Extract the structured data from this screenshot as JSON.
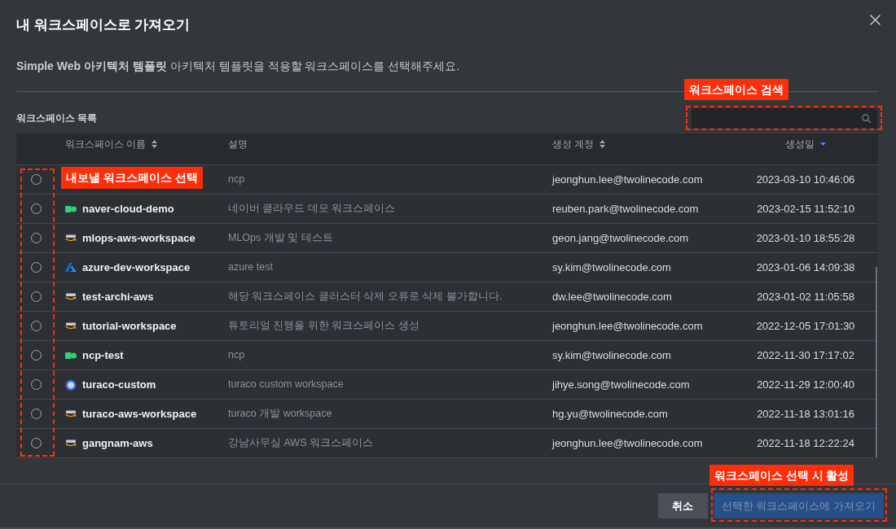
{
  "dialog": {
    "title": "내 워크스페이스로 가져오기"
  },
  "description": "**Simple Web 아키텍처 템플릿** 아키텍처 템플릿을 적용할 워크스페이스를 선택해주세요.",
  "list_title": "워크스페이스 목록",
  "search": {
    "annotation": "워크스페이스 검색"
  },
  "table": {
    "annotation": "내보낼 워크스페이스 선택",
    "columns": [
      {
        "label": "워크스페이스 이름",
        "sortable": true,
        "sorted": false
      },
      {
        "label": "설명",
        "sortable": false,
        "sorted": false
      },
      {
        "label": "생성 계정",
        "sortable": true,
        "sorted": false
      },
      {
        "label": "생성일",
        "sortable": true,
        "sorted": true
      }
    ],
    "rows": [
      {
        "selected": false,
        "description": "ncp",
        "account": "jeonghun.lee@twolinecode.com",
        "created": "2023-03-10 10:46:06"
      },
      {
        "selected": false,
        "kind": "ncp",
        "name": "naver-cloud-demo",
        "description": "네이버 클라우드 데모 워크스페이스",
        "account": "reuben.park@twolinecode.com",
        "created": "2023-02-15 11:52:10"
      },
      {
        "selected": false,
        "kind": "aws",
        "name": "mlops-aws-workspace",
        "description": "MLOps 개발 및 테스트",
        "account": "geon.jang@twolinecode.com",
        "created": "2023-01-10 18:55:28"
      },
      {
        "selected": false,
        "kind": "azure",
        "name": "azure-dev-workspace",
        "description": "azure test",
        "account": "sy.kim@twolinecode.com",
        "created": "2023-01-06 14:09:38"
      },
      {
        "selected": false,
        "kind": "aws",
        "name": "test-archi-aws",
        "description": "해당 워크스페이스 클러스터 삭제 오류로 삭제 불가합니다.",
        "account": "dw.lee@twolinecode.com",
        "created": "2023-01-02 11:05:58"
      },
      {
        "selected": false,
        "kind": "aws",
        "name": "tutorial-workspace",
        "description": "튜토리얼 진행을 위한 워크스페이스 생성",
        "account": "jeonghun.lee@twolinecode.com",
        "created": "2022-12-05 17:01:30"
      },
      {
        "selected": false,
        "kind": "ncp",
        "name": "ncp-test",
        "description": "ncp",
        "account": "sy.kim@twolinecode.com",
        "created": "2022-11-30 17:17:02"
      },
      {
        "selected": false,
        "kind": "kubernetes",
        "name": "turaco-custom",
        "description": "turaco custom workspace",
        "account": "jihye.song@twolinecode.com",
        "created": "2022-11-29 12:00:40"
      },
      {
        "selected": false,
        "kind": "aws",
        "name": "turaco-aws-workspace",
        "description": "turaco 개발 workspace",
        "account": "hg.yu@twolinecode.com",
        "created": "2022-11-18 13:01:16"
      },
      {
        "selected": false,
        "kind": "aws",
        "name": "gangnam-aws",
        "description": "강남사무실 AWS 워크스페이스",
        "account": "jeonghun.lee@twolinecode.com",
        "created": "2022-11-18 12:22:24"
      }
    ]
  },
  "buttons": [
    {
      "label": "취소",
      "kind": "secondary",
      "disabled": false
    },
    {
      "label": "선택한 워크스페이스에 가져오기",
      "kind": "primary",
      "disabled": true,
      "annotation": "워크스페이스 선택 시 활성"
    }
  ]
}
